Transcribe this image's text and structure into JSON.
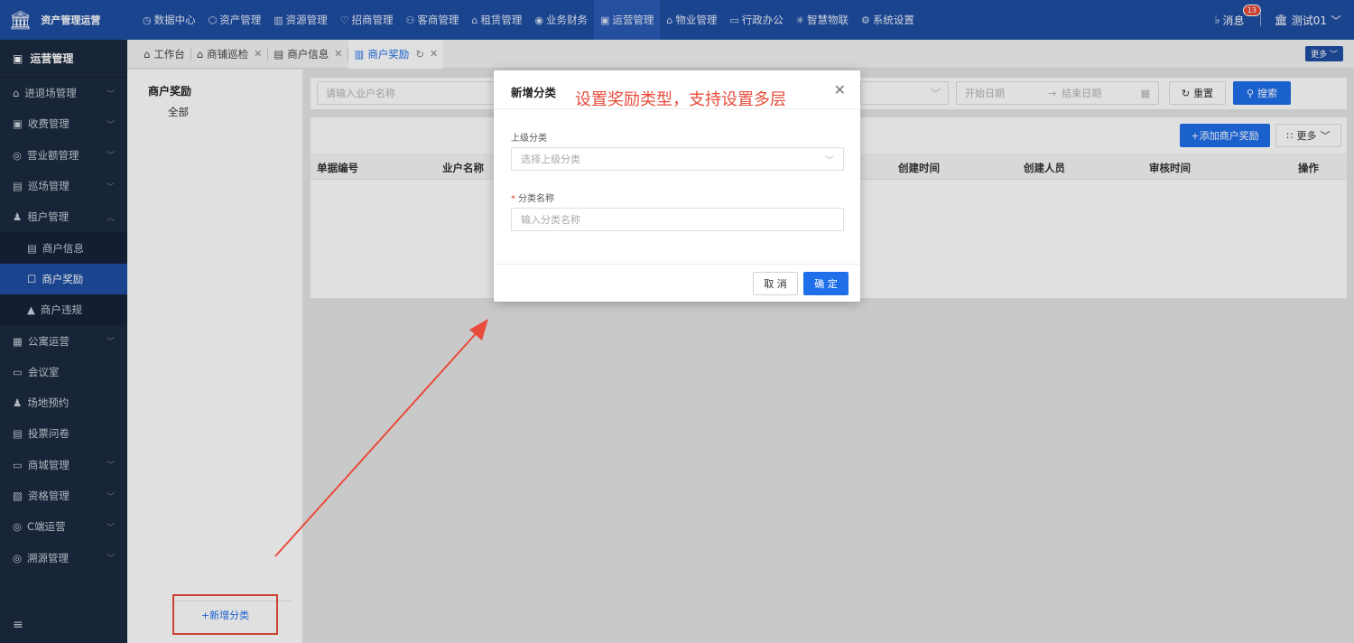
{
  "app": {
    "title": "资产管理运营"
  },
  "nav": [
    {
      "label": "数据中心",
      "icon": "clock-icon",
      "active": false
    },
    {
      "label": "资产管理",
      "icon": "cube-icon",
      "active": false
    },
    {
      "label": "资源管理",
      "icon": "building-icon",
      "active": false
    },
    {
      "label": "招商管理",
      "icon": "handshake-icon",
      "active": false
    },
    {
      "label": "客商管理",
      "icon": "people-icon",
      "active": false
    },
    {
      "label": "租赁管理",
      "icon": "house-icon",
      "active": false
    },
    {
      "label": "业务财务",
      "icon": "coin-icon",
      "active": false
    },
    {
      "label": "运营管理",
      "icon": "chart-icon",
      "active": true
    },
    {
      "label": "物业管理",
      "icon": "home-icon",
      "active": false
    },
    {
      "label": "行政办公",
      "icon": "monitor-icon",
      "active": false
    },
    {
      "label": "智慧物联",
      "icon": "sun-icon",
      "active": false
    },
    {
      "label": "系统设置",
      "icon": "gear-icon",
      "active": false
    }
  ],
  "header": {
    "messages_label": "消息",
    "message_count": "13",
    "user_name": "测试01"
  },
  "sidebar": {
    "section": "运营管理",
    "items": [
      {
        "label": "进退场管理",
        "chev": "﹀"
      },
      {
        "label": "收费管理",
        "chev": "﹀"
      },
      {
        "label": "营业额管理",
        "chev": "﹀"
      },
      {
        "label": "巡场管理",
        "chev": "﹀"
      },
      {
        "label": "租户管理",
        "chev": "︿"
      },
      {
        "label": "商户信息",
        "sub": true
      },
      {
        "label": "商户奖励",
        "sub": true,
        "active": true
      },
      {
        "label": "商户违规",
        "sub": true
      },
      {
        "label": "公寓运营",
        "chev": "﹀"
      },
      {
        "label": "会议室"
      },
      {
        "label": "场地预约"
      },
      {
        "label": "投票问卷"
      },
      {
        "label": "商城管理",
        "chev": "﹀"
      },
      {
        "label": "资格管理",
        "chev": "﹀"
      },
      {
        "label": "C端运营",
        "chev": "﹀"
      },
      {
        "label": "溯源管理",
        "chev": "﹀"
      }
    ]
  },
  "tabs": [
    {
      "label": "工作台",
      "closable": false
    },
    {
      "label": "商铺巡检",
      "closable": true
    },
    {
      "label": "商户信息",
      "closable": true
    },
    {
      "label": "商户奖励",
      "closable": true,
      "active": true
    }
  ],
  "tabs_more": "更多 ﹀",
  "category_panel": {
    "title": "商户奖励",
    "all": "全部",
    "add_label": "+新增分类"
  },
  "filters": {
    "tenant_placeholder": "请输入业户名称",
    "start_date": "开始日期",
    "range_sep": "→",
    "end_date": "结束日期",
    "reset_label": "重置",
    "search_label": "搜索"
  },
  "table": {
    "add_button": "+添加商户奖励",
    "more_button": "更多",
    "columns": [
      "单据编号",
      "业户名称",
      "创建时间",
      "创建人员",
      "审核时间",
      "操作"
    ]
  },
  "modal": {
    "title": "新增分类",
    "parent_label": "上级分类",
    "parent_placeholder": "选择上级分类",
    "name_label": "分类名称",
    "name_placeholder": "输入分类名称",
    "cancel_label": "取 消",
    "ok_label": "确 定"
  },
  "annotation": {
    "text": "设置奖励类型，支持设置多层",
    "color": "#e84c3d"
  },
  "colors": {
    "topbar": "#1f4ea3",
    "sidebar": "#1c2a3f",
    "primary": "#1f6feb"
  }
}
